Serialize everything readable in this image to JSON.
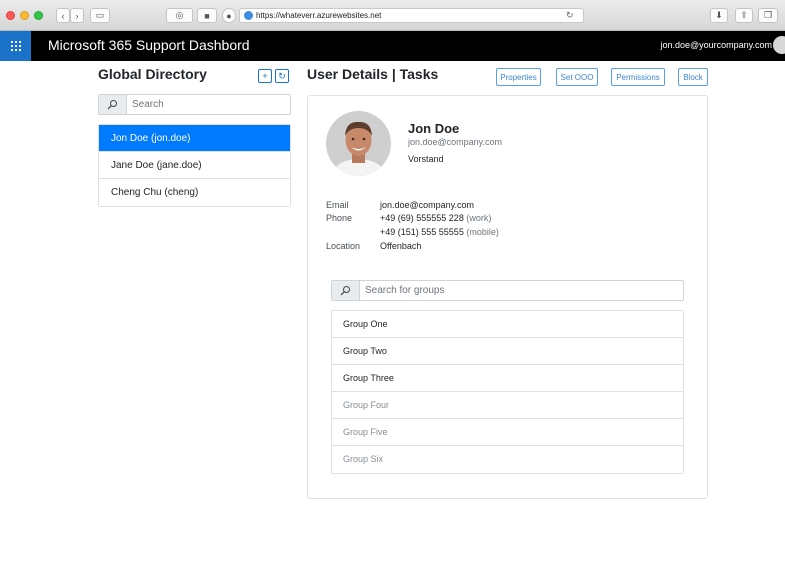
{
  "browser": {
    "url": "https://whateverr.azurewebsites.net"
  },
  "header": {
    "app_title": "Microsoft 365 Support Dashbord",
    "user_email": "jon.doe@yourcompany.com"
  },
  "directory": {
    "title": "Global Directory",
    "add_label": "+",
    "refresh_label": "↻",
    "search_placeholder": "Search",
    "users": [
      {
        "label": "Jon Doe (jon.doe)",
        "active": true
      },
      {
        "label": "Jane Doe (jane.doe)",
        "active": false
      },
      {
        "label": "Cheng Chu (cheng)",
        "active": false
      }
    ]
  },
  "details": {
    "title": "User Details | Tasks",
    "actions": {
      "properties": "Properties",
      "set_ooo": "Set OOO",
      "permissions": "Permissions",
      "block": "Block"
    },
    "profile": {
      "name": "Jon Doe",
      "email": "jon.doe@company.com",
      "role": "Vorstand"
    },
    "fields": {
      "email_label": "Email",
      "email_value": "jon.doe@company.com",
      "phone_label": "Phone",
      "phone_work": "+49 (69) 555555 228",
      "phone_work_tag": "(work)",
      "phone_mobile": "+49 (151) 555 55555",
      "phone_mobile_tag": "(mobile)",
      "location_label": "Location",
      "location_value": "Offenbach"
    },
    "groups": {
      "search_placeholder": "Search for groups",
      "items": [
        {
          "label": "Group One",
          "disabled": false
        },
        {
          "label": "Group Two",
          "disabled": false
        },
        {
          "label": "Group Three",
          "disabled": false
        },
        {
          "label": "Group Four",
          "disabled": true
        },
        {
          "label": "Group Five",
          "disabled": true
        },
        {
          "label": "Group Six",
          "disabled": true
        }
      ]
    }
  },
  "colors": {
    "primary": "#007bff",
    "header_bg": "#000000",
    "waffle_bg": "#1a73c9"
  }
}
